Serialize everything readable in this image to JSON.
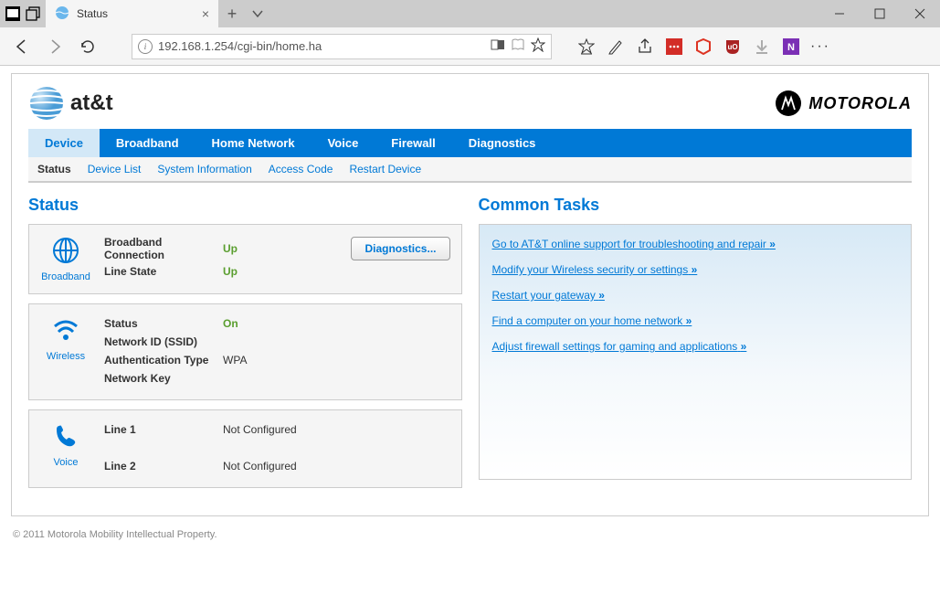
{
  "browser": {
    "tab_title": "Status",
    "url": "192.168.1.254/cgi-bin/home.ha"
  },
  "brand": {
    "att": "at&t",
    "motorola": "MOTOROLA"
  },
  "main_tabs": [
    "Device",
    "Broadband",
    "Home Network",
    "Voice",
    "Firewall",
    "Diagnostics"
  ],
  "sub_tabs": [
    "Status",
    "Device List",
    "System Information",
    "Access Code",
    "Restart Device"
  ],
  "left_heading": "Status",
  "right_heading": "Common Tasks",
  "broadband": {
    "label": "Broadband",
    "rows": [
      {
        "key": "Broadband Connection",
        "val": "Up",
        "green": true
      },
      {
        "key": "Line State",
        "val": "Up",
        "green": true
      }
    ],
    "button": "Diagnostics..."
  },
  "wireless": {
    "label": "Wireless",
    "rows": [
      {
        "key": "Status",
        "val": "On",
        "green": true
      },
      {
        "key": "Network ID (SSID)",
        "val": ""
      },
      {
        "key": "Authentication Type",
        "val": "WPA"
      },
      {
        "key": "Network Key",
        "val": ""
      }
    ]
  },
  "voice": {
    "label": "Voice",
    "rows": [
      {
        "key": "Line 1",
        "val": "Not Configured"
      },
      {
        "key": "Line 2",
        "val": "Not Configured"
      }
    ]
  },
  "tasks": [
    "Go to AT&T online support for troubleshooting and repair",
    "Modify your Wireless security or settings",
    "Restart your gateway",
    "Find a computer on your home network",
    "Adjust firewall settings for gaming and applications"
  ],
  "footer": "© 2011 Motorola Mobility Intellectual Property."
}
